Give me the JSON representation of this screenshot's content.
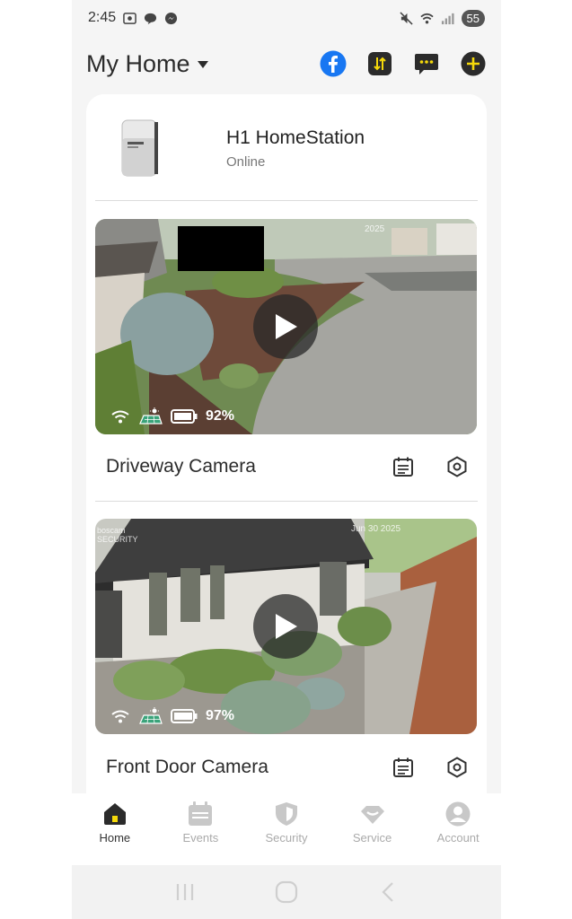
{
  "status_bar": {
    "time": "2:45",
    "battery": "55",
    "left_icons": [
      "gallery-icon",
      "chat-bubble-icon",
      "messenger-icon"
    ],
    "right_icons": [
      "mute-icon",
      "wifi-icon",
      "signal-icon"
    ]
  },
  "header": {
    "title": "My Home",
    "actions": [
      "facebook-icon",
      "sort-icon",
      "message-icon",
      "add-icon"
    ],
    "accent": "#f5d90a"
  },
  "hub": {
    "name": "H1 HomeStation",
    "status": "Online"
  },
  "cameras": [
    {
      "name": "Driveway Camera",
      "battery": "92%",
      "timestamp": "2025"
    },
    {
      "name": "Front Door Camera",
      "battery": "97%",
      "timestamp": "Jun 30 2025",
      "brand": "boscam SECURITY"
    }
  ],
  "nav": {
    "items": [
      {
        "label": "Home",
        "icon": "home-icon",
        "active": true
      },
      {
        "label": "Events",
        "icon": "calendar-icon",
        "active": false
      },
      {
        "label": "Security",
        "icon": "shield-icon",
        "active": false
      },
      {
        "label": "Service",
        "icon": "service-icon",
        "active": false
      },
      {
        "label": "Account",
        "icon": "account-icon",
        "active": false
      }
    ]
  },
  "system_nav": [
    "recents-icon",
    "home-circle-icon",
    "back-icon"
  ]
}
